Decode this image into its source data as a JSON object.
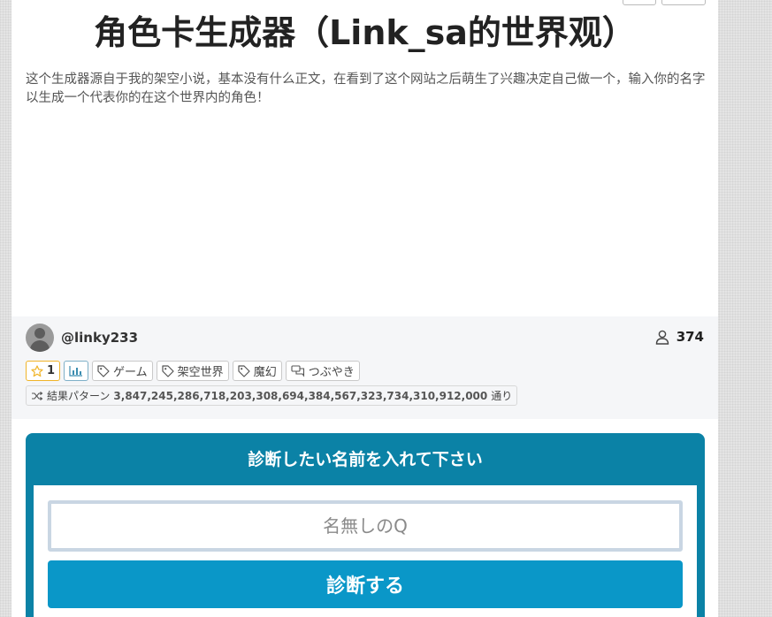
{
  "header": {
    "title": "角色卡生成器（Link_sa的世界观）"
  },
  "description": "这个生成器源自于我的架空小说，基本没有什么正文，在看到了这个网站之后萌生了兴趣决定自己做一个，输入你的名字以生成一个代表你的在这个世界内的角色！",
  "author": {
    "handle": "@linky233",
    "view_count": "374"
  },
  "tags": {
    "favorite_count": "1",
    "items": [
      "ゲーム",
      "架空世界",
      "魔幻"
    ],
    "tweet_label": "つぶやき",
    "pattern_label": "結果パターン",
    "pattern_value": "3,847,245,286,718,203,308,694,384,567,323,734,310,912,000",
    "pattern_unit": "通り"
  },
  "form": {
    "title": "診断したい名前を入れて下さい",
    "input_placeholder": "名無しのQ",
    "submit_label": "診断する"
  },
  "colors": {
    "accent": "#0b82a6",
    "button": "#0a97c8",
    "favorite_border": "#f0b429"
  },
  "icons": [
    "star-icon",
    "bar-chart-icon",
    "tag-icon",
    "chat-icon",
    "shuffle-icon",
    "user-icon"
  ]
}
